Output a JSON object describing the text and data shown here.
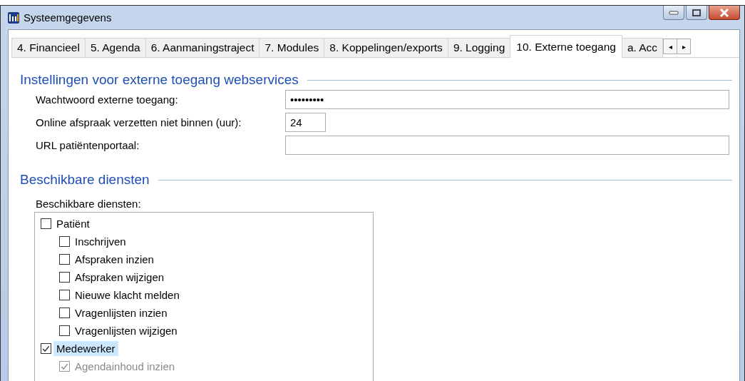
{
  "window": {
    "title": "Systeemgegevens"
  },
  "tabs": [
    {
      "label": "4. Financieel",
      "selected": false
    },
    {
      "label": "5. Agenda",
      "selected": false
    },
    {
      "label": "6. Aanmaningstraject",
      "selected": false
    },
    {
      "label": "7. Modules",
      "selected": false
    },
    {
      "label": "8. Koppelingen/exports",
      "selected": false
    },
    {
      "label": "9. Logging",
      "selected": false
    },
    {
      "label": "10. Externe toegang",
      "selected": true
    },
    {
      "label": "a. Acc",
      "selected": false
    }
  ],
  "tab_scroll": [
    "◂",
    "▸"
  ],
  "sections": [
    {
      "title": "Instellingen voor externe toegang webservices",
      "fields": [
        {
          "label": "Wachtwoord externe toegang:",
          "value": "•••••••••",
          "kind": "text"
        },
        {
          "label": "Online afspraak verzetten niet binnen (uur):",
          "value": "24",
          "kind": "number"
        },
        {
          "label": "URL patiëntenportaal:",
          "kind": "text"
        }
      ]
    },
    {
      "title": "Beschikbare diensten",
      "list_label": "Beschikbare diensten:",
      "tree": [
        {
          "label": "Patiënt",
          "checked": false,
          "selected": false,
          "disabled": false,
          "children": [
            {
              "label": "Inschrijven",
              "checked": false,
              "selected": false,
              "disabled": false
            },
            {
              "label": "Afspraken inzien",
              "checked": false,
              "selected": false,
              "disabled": false
            },
            {
              "label": "Afspraken wijzigen",
              "checked": false,
              "selected": false,
              "disabled": false
            },
            {
              "label": "Nieuwe klacht melden",
              "checked": false,
              "selected": false,
              "disabled": false
            },
            {
              "label": "Vragenlijsten inzien",
              "checked": false,
              "selected": false,
              "disabled": false
            },
            {
              "label": "Vragenlijsten wijzigen",
              "checked": false,
              "selected": false,
              "disabled": false
            }
          ]
        },
        {
          "label": "Medewerker",
          "checked": true,
          "selected": true,
          "disabled": false,
          "children": [
            {
              "label": "Agendainhoud inzien",
              "checked": true,
              "selected": false,
              "disabled": true
            }
          ]
        }
      ]
    }
  ]
}
